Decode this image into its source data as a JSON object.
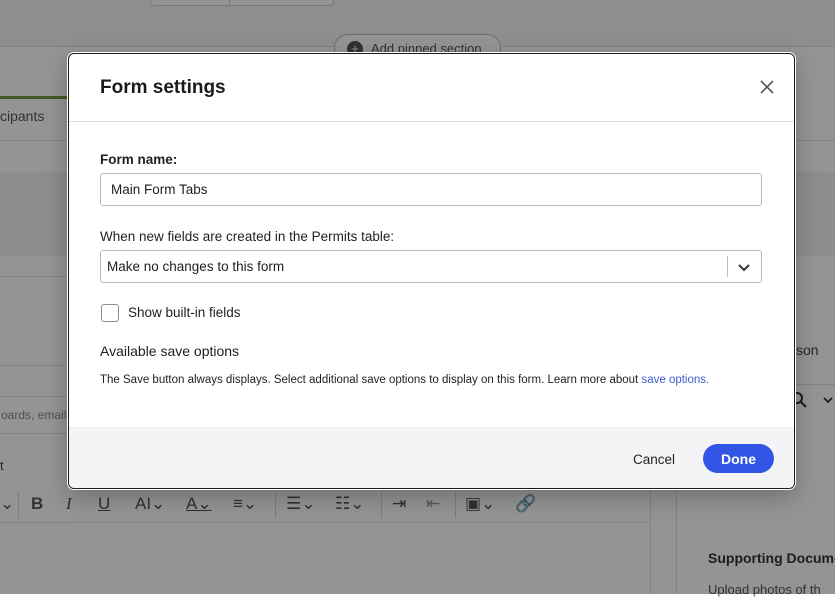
{
  "background": {
    "pinned_section_label": "Add pinned section",
    "tab_label": "cipants",
    "search_placeholder": "oards, email",
    "person_label": "son",
    "supporting_label": "Supporting Docume",
    "upload_label": "Upload photos of th",
    "left_marker": "t"
  },
  "dialog": {
    "title": "Form settings",
    "form_name_label": "Form name:",
    "form_name_value": "Main Form Tabs",
    "new_fields_label": "When new fields are created in the Permits table:",
    "new_fields_selected": "Make no changes to this form",
    "show_builtin_label": "Show built-in fields",
    "show_builtin_checked": false,
    "save_options_heading": "Available save options",
    "save_options_text": "The Save button always displays. Select additional save options to display on this form. Learn more about",
    "save_options_link": "save options.",
    "cancel_label": "Cancel",
    "done_label": "Done"
  },
  "colors": {
    "primary": "#3355e6",
    "link": "#3a5ccc",
    "overlay": "rgba(0,0,0,0.42)"
  },
  "icons": [
    "close-icon",
    "chevron-down-icon",
    "plus-icon",
    "bold-icon",
    "italic-icon",
    "underline-icon",
    "text-size-icon",
    "text-color-icon",
    "align-icon",
    "bullet-list-icon",
    "numbered-list-icon",
    "indent-icon",
    "outdent-icon",
    "image-icon",
    "link-icon",
    "search-icon"
  ]
}
